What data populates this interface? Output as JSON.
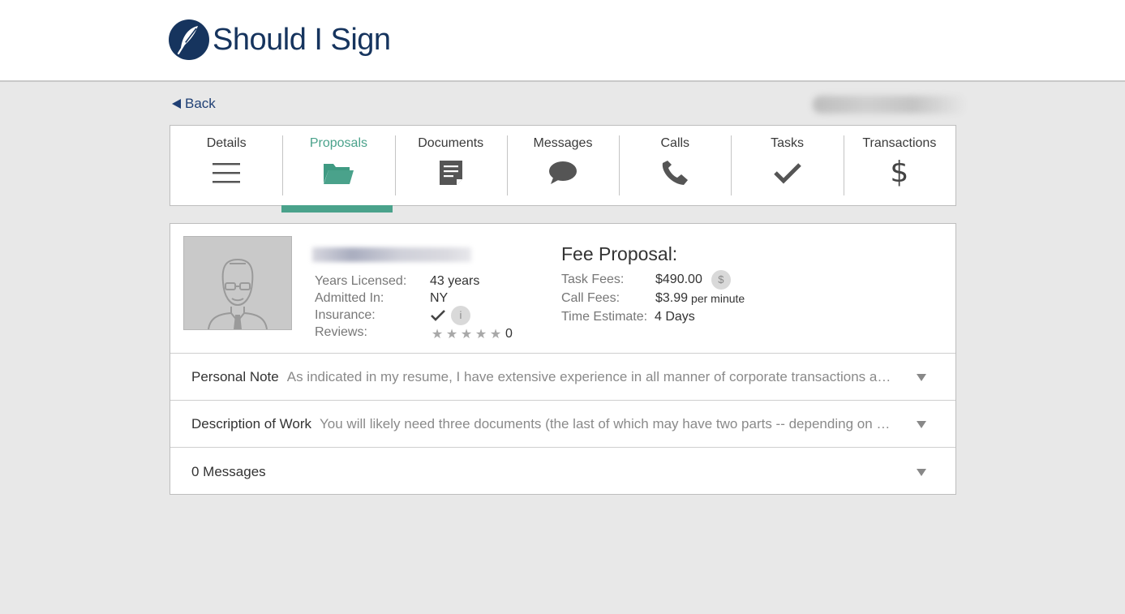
{
  "app": {
    "name": "Should I Sign"
  },
  "nav": {
    "back_label": "Back"
  },
  "tabs": [
    {
      "label": "Details",
      "icon": "list-icon",
      "active": false
    },
    {
      "label": "Proposals",
      "icon": "folder-icon",
      "active": true
    },
    {
      "label": "Documents",
      "icon": "document-icon",
      "active": false
    },
    {
      "label": "Messages",
      "icon": "chat-bubble-icon",
      "active": false
    },
    {
      "label": "Calls",
      "icon": "phone-icon",
      "active": false
    },
    {
      "label": "Tasks",
      "icon": "checkmark-icon",
      "active": false
    },
    {
      "label": "Transactions",
      "icon": "dollar-icon",
      "active": false,
      "icon_glyph": "$"
    }
  ],
  "attorney": {
    "years_label": "Years Licensed:",
    "years_value": "43 years",
    "admitted_label": "Admitted In:",
    "admitted_value": "NY",
    "insurance_label": "Insurance:",
    "insurance_info": "i",
    "reviews_label": "Reviews:",
    "rating": 0,
    "reviews_count": "0"
  },
  "fee": {
    "title": "Fee Proposal:",
    "task_label": "Task Fees:",
    "task_value": "$490.00",
    "task_button": "$",
    "call_label": "Call Fees:",
    "call_value": "$3.99",
    "call_unit": "per minute",
    "time_label": "Time Estimate:",
    "time_value": "4 Days"
  },
  "sections": [
    {
      "title": "Personal Note",
      "preview": "As indicated in my resume, I have extensive experience in all manner of corporate transactions and contracts."
    },
    {
      "title": "Description of Work",
      "preview": "You will likely need three documents (the last of which may have two parts -- depending on the structure)."
    },
    {
      "title": "0 Messages",
      "preview": ""
    }
  ],
  "colors": {
    "brand_navy": "#16345e",
    "accent_green": "#4aa28b",
    "page_bg": "#e8e8e8"
  }
}
